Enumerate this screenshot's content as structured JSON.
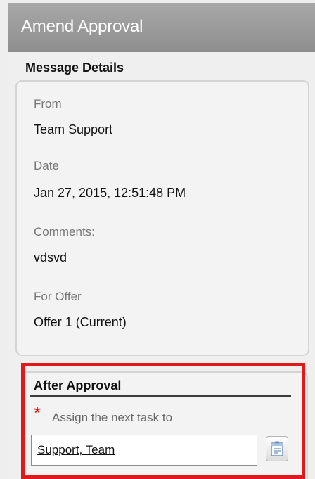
{
  "window": {
    "title": "Amend Approval"
  },
  "message_details": {
    "heading": "Message Details",
    "fields": [
      {
        "label": "From",
        "value": "Team Support"
      },
      {
        "label": "Date",
        "value": "Jan 27, 2015, 12:51:48 PM"
      },
      {
        "label": "Comments:",
        "value": "vdsvd"
      },
      {
        "label": "For Offer",
        "value": "Offer 1 (Current)"
      }
    ]
  },
  "after_approval": {
    "heading": "After Approval",
    "required_marker": "*",
    "assign_label": "Assign the next task to",
    "assignee_value": "Support, Team",
    "lookup_icon": "directory-lookup-icon"
  },
  "colors": {
    "title_bar": "#9b9b9b",
    "highlight_border": "#e11919",
    "required_star": "#e01010"
  }
}
